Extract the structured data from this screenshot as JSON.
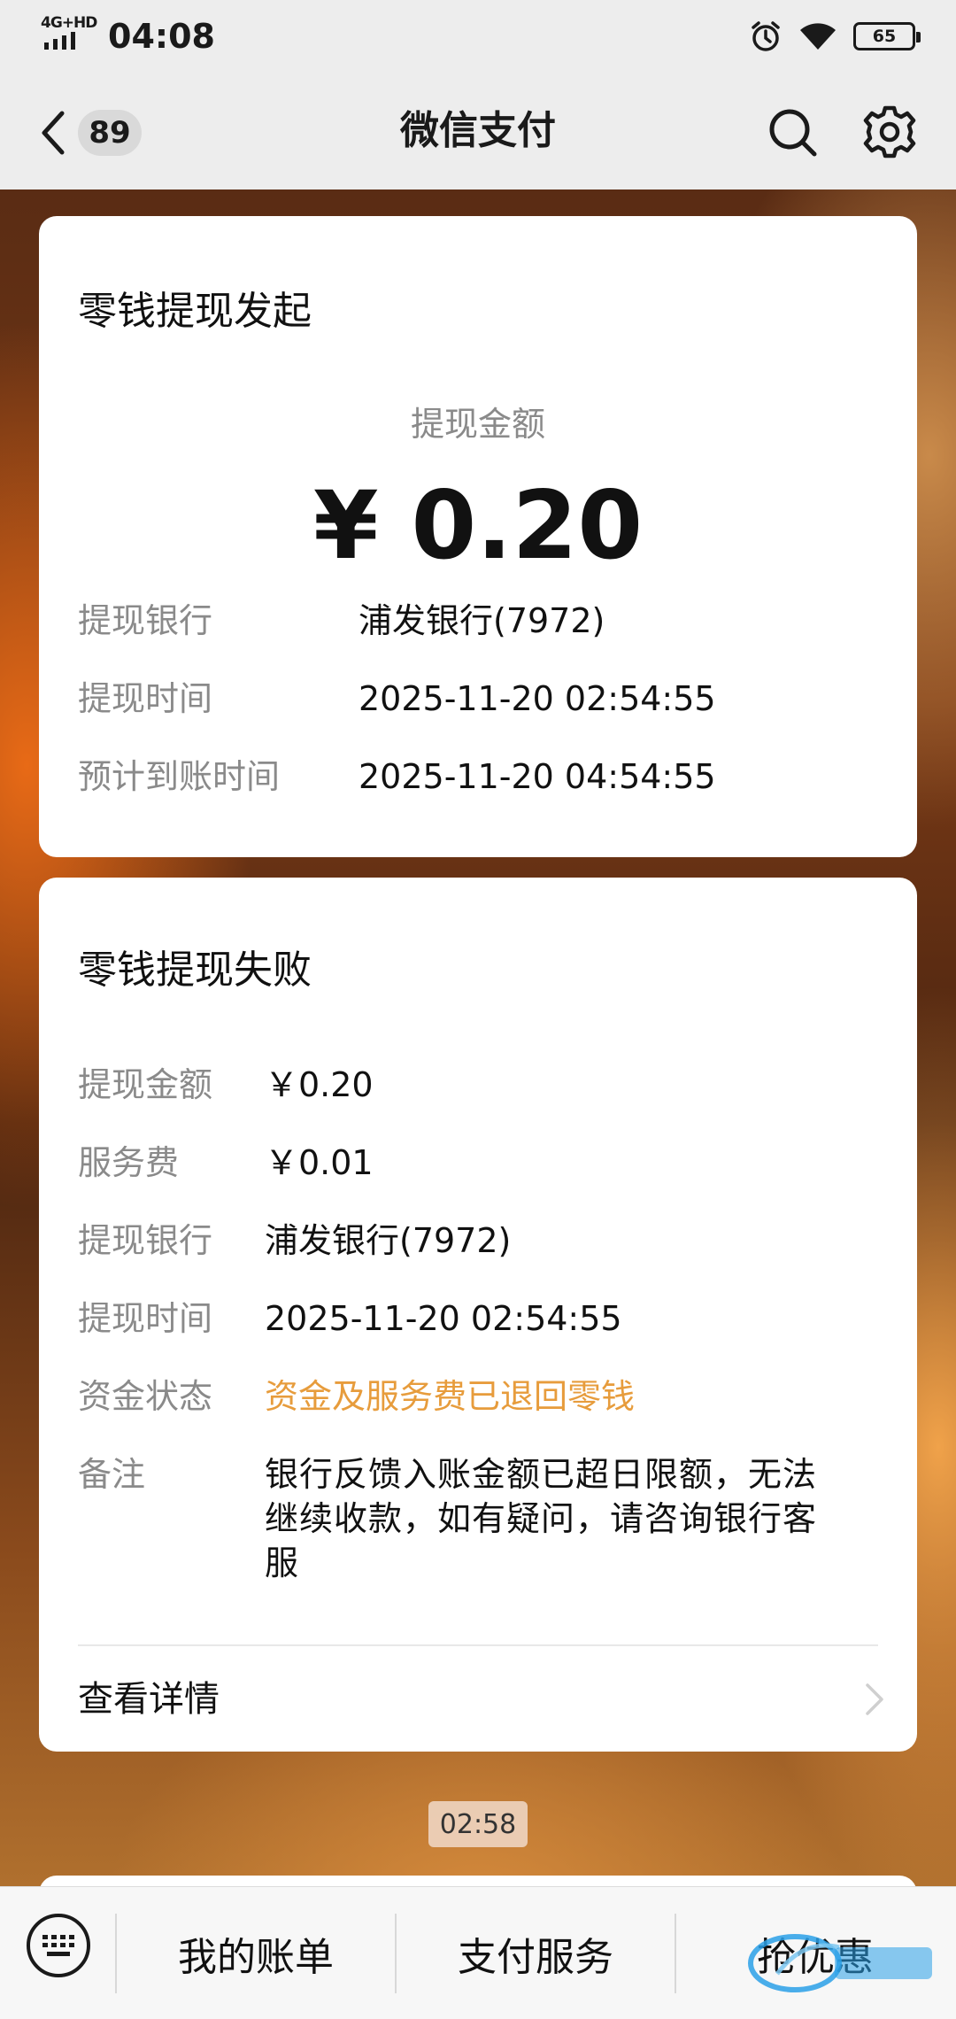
{
  "status_bar": {
    "signal": "4G+HD",
    "time": "04:08",
    "battery": "65"
  },
  "nav": {
    "unread_count": "89",
    "title": "微信支付"
  },
  "card_initiated": {
    "title": "零钱提现发起",
    "amount_label": "提现金额",
    "amount_value": "¥ 0.20",
    "rows": [
      {
        "label": "提现银行",
        "value": "浦发银行(7972)"
      },
      {
        "label": "提现时间",
        "value": "2025-11-20 02:54:55"
      },
      {
        "label": "预计到账时间",
        "value": "2025-11-20 04:54:55"
      }
    ]
  },
  "card_failed": {
    "title": "零钱提现失败",
    "rows": [
      {
        "label": "提现金额",
        "value": "￥0.20"
      },
      {
        "label": "服务费",
        "value": "￥0.01"
      },
      {
        "label": "提现银行",
        "value": "浦发银行(7972)"
      },
      {
        "label": "提现时间",
        "value": "2025-11-20 02:54:55"
      },
      {
        "label": "资金状态",
        "value": "资金及服务费已退回零钱"
      },
      {
        "label": "备注",
        "value_lines": [
          "银行反馈入账金额已超日限额，无法",
          "继续收款，如有疑问，请咨询银行客",
          "服"
        ]
      }
    ],
    "detail_link": "查看详情"
  },
  "timestamp": "02:58",
  "bottom_menu": {
    "items": [
      "我的账单",
      "支付服务",
      "抢优惠"
    ]
  },
  "colors": {
    "status_orange": "#e79c3c",
    "bar_bg": "#ededed"
  }
}
